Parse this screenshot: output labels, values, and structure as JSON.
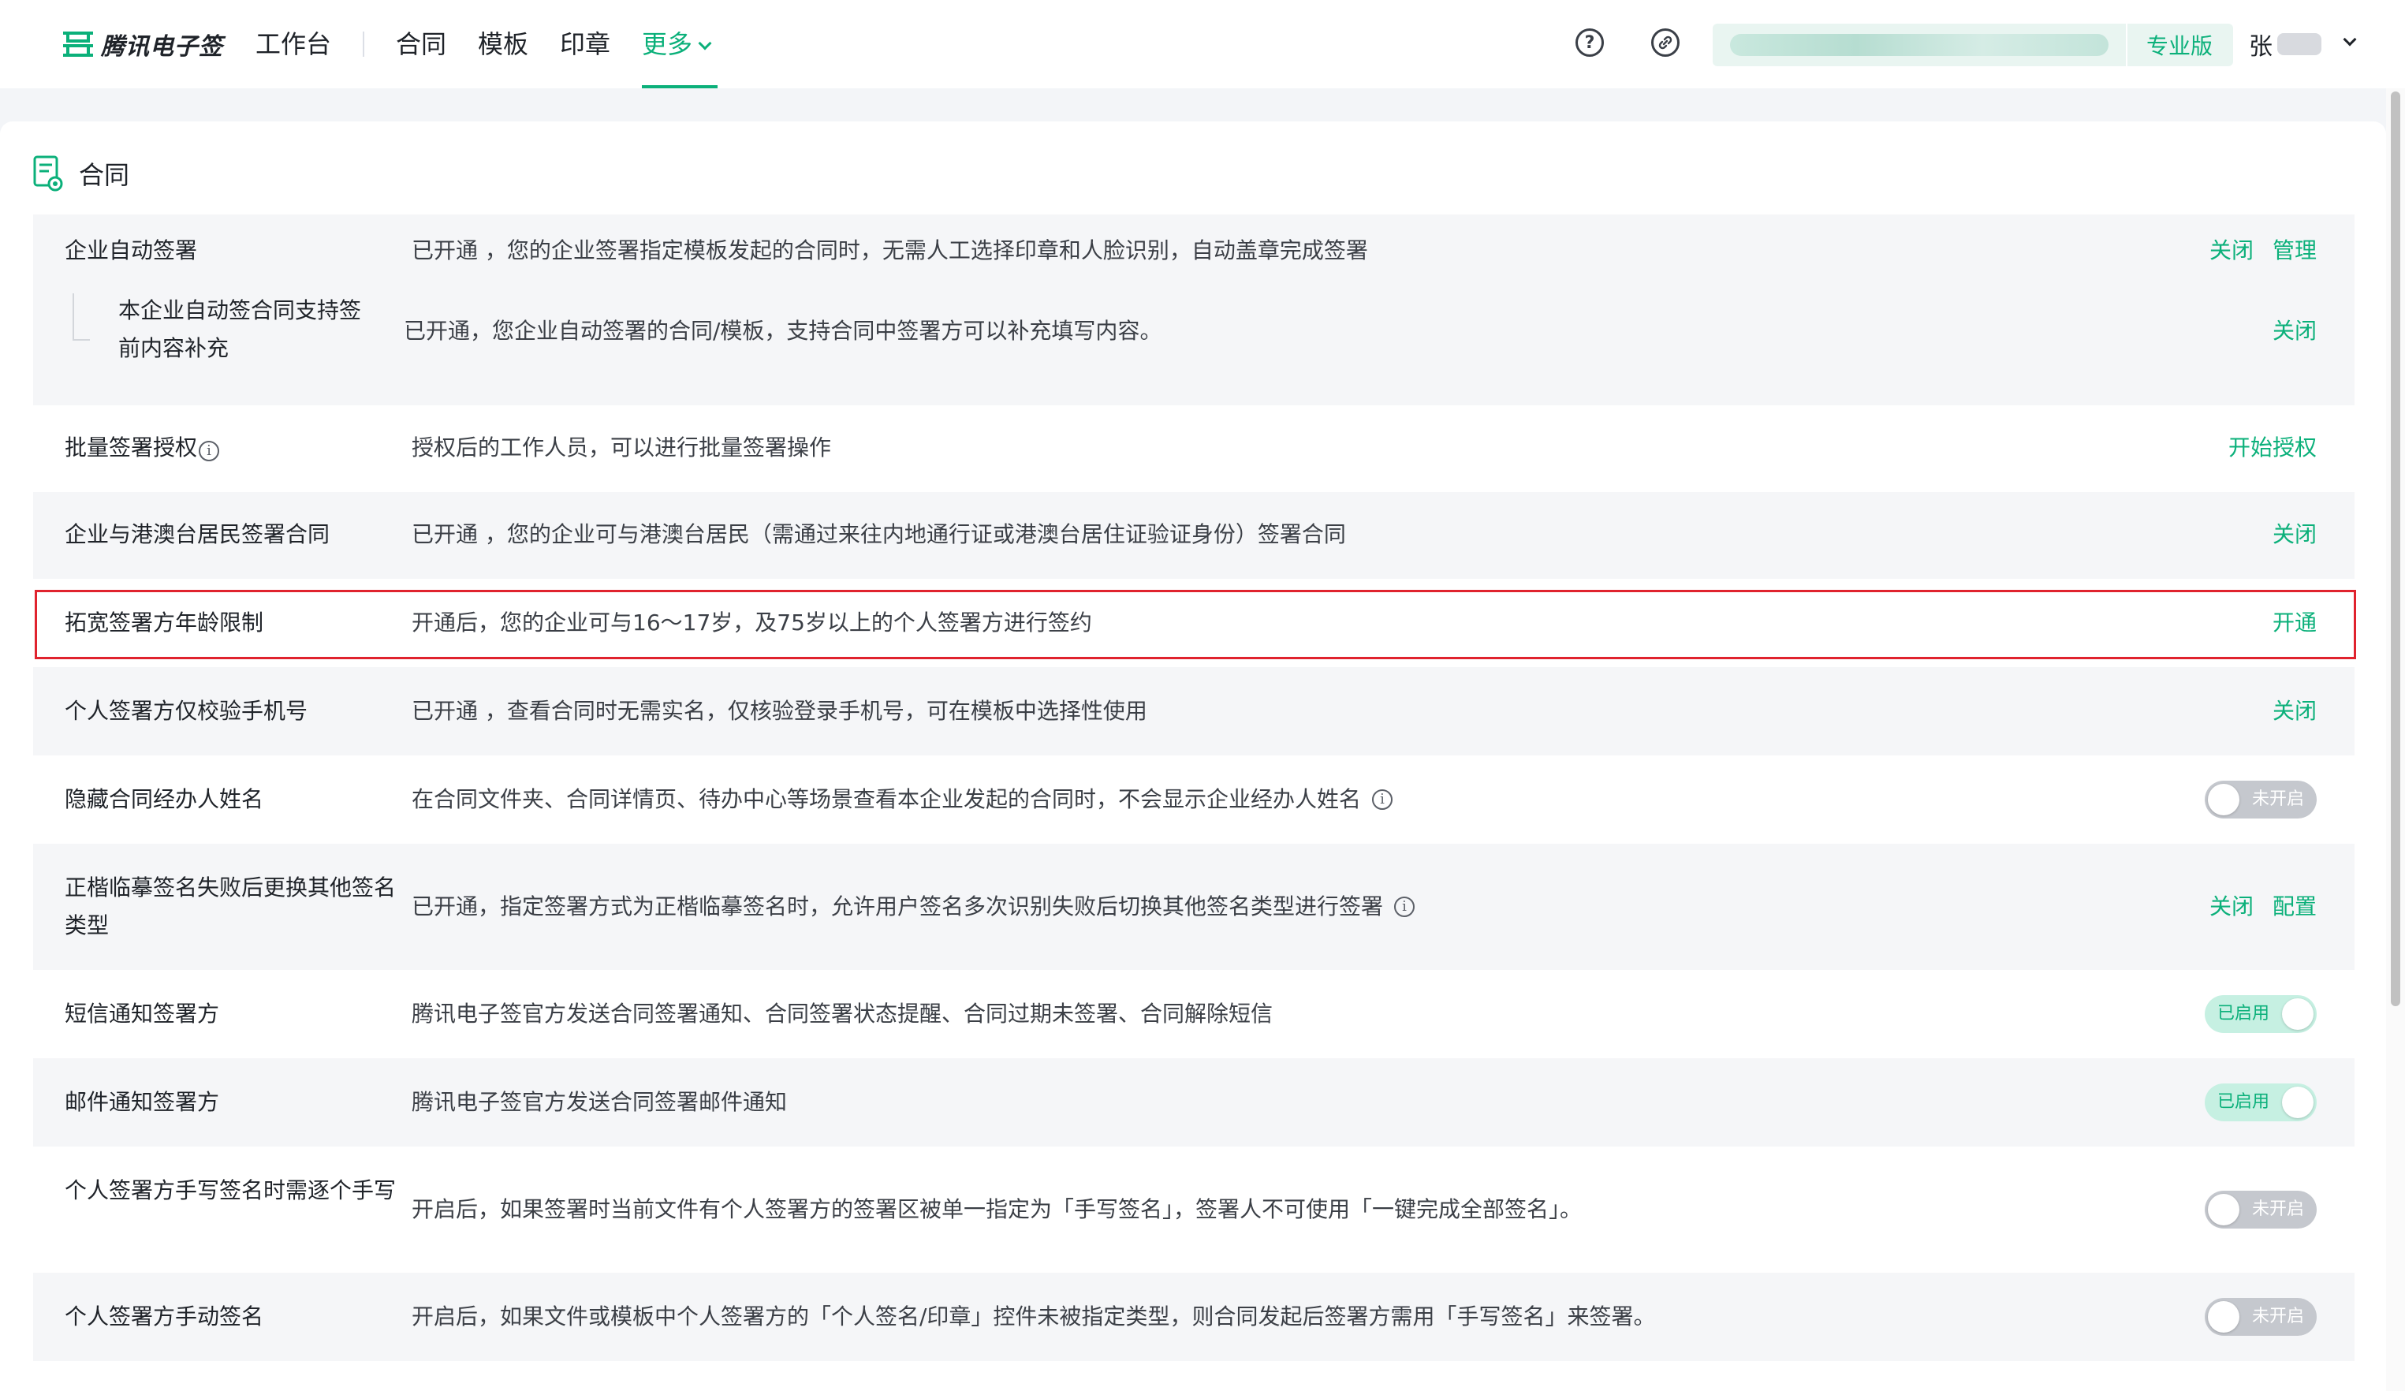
{
  "brand": {
    "name": "腾讯电子签",
    "accent": "#0bb07a"
  },
  "nav": {
    "workbench": "工作台",
    "contract": "合同",
    "template": "模板",
    "seal": "印章",
    "more": "更多"
  },
  "header": {
    "help_icon": "question-circle-icon",
    "link_icon": "link-circle-icon",
    "edition": "专业版",
    "user_initial": "张"
  },
  "section": {
    "title": "合同",
    "icon": "contract-document-icon"
  },
  "rows": [
    {
      "name": "企业自动签署",
      "desc": "已开通 ，您的企业签署指定模板发起的合同时，无需人工选择印章和人脸识别，自动盖章完成签署",
      "actions": [
        "关闭",
        "管理"
      ]
    },
    {
      "name": "本企业自动签合同支持签前内容补充",
      "desc": "已开通，您企业自动签署的合同/模板，支持合同中签署方可以补充填写内容。",
      "actions": [
        "关闭"
      ]
    },
    {
      "name": "批量签署授权",
      "desc": "授权后的工作人员，可以进行批量签署操作",
      "actions": [
        "开始授权"
      ]
    },
    {
      "name": "企业与港澳台居民签署合同",
      "desc": "已开通 ，您的企业可与港澳台居民（需通过来往内地通行证或港澳台居住证验证身份）签署合同",
      "actions": [
        "关闭"
      ]
    },
    {
      "name": "拓宽签署方年龄限制",
      "desc": "开通后，您的企业可与16～17岁，及75岁以上的个人签署方进行签约",
      "actions": [
        "开通"
      ]
    },
    {
      "name": "个人签署方仅校验手机号",
      "desc": "已开通 ，查看合同时无需实名，仅核验登录手机号，可在模板中选择性使用",
      "actions": [
        "关闭"
      ]
    },
    {
      "name": "隐藏合同经办人姓名",
      "desc": "在合同文件夹、合同详情页、待办中心等场景查看本企业发起的合同时，不会显示企业经办人姓名",
      "toggle": "未开启"
    },
    {
      "name": "正楷临摹签名失败后更换其他签名类型",
      "desc": "已开通，指定签署方式为正楷临摹签名时，允许用户签名多次识别失败后切换其他签名类型进行签署",
      "actions": [
        "关闭",
        "配置"
      ]
    },
    {
      "name": "短信通知签署方",
      "desc": "腾讯电子签官方发送合同签署通知、合同签署状态提醒、合同过期未签署、合同解除短信",
      "toggle": "已启用"
    },
    {
      "name": "邮件通知签署方",
      "desc": "腾讯电子签官方发送合同签署邮件通知",
      "toggle": "已启用"
    },
    {
      "name": "个人签署方手写签名时需逐个手写",
      "desc": "开启后，如果签署时当前文件有个人签署方的签署区被单一指定为「手写签名」，签署人不可使用「一键完成全部签名」。",
      "toggle": "未开启"
    },
    {
      "name": "个人签署方手动签名",
      "desc": "开启后，如果文件或模板中个人签署方的「个人签名/印章」控件未被指定类型，则合同发起后签署方需用「手写签名」来签署。",
      "toggle": "未开启"
    }
  ]
}
